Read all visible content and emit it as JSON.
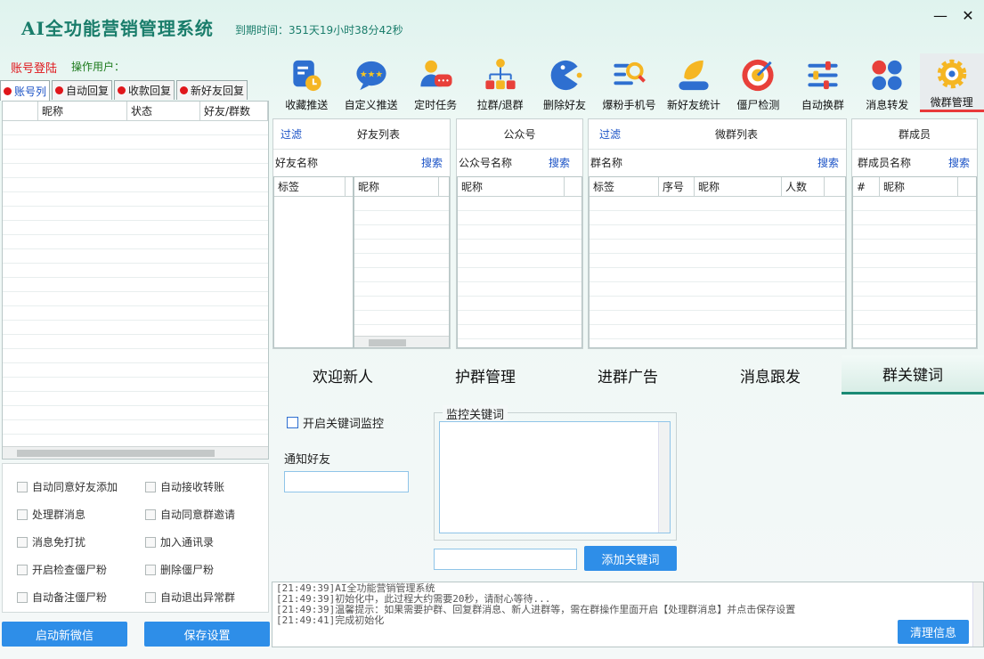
{
  "app": {
    "title": "AI全功能营销管理系统",
    "expire": "到期时间：351天19小时38分42秒"
  },
  "window": {
    "minimize": "—",
    "close": "✕"
  },
  "account": {
    "login": "账号登陆",
    "operator": "操作用户："
  },
  "toolbar": [
    {
      "label": "收藏推送",
      "icon": "bookmark-clock-icon"
    },
    {
      "label": "自定义推送",
      "icon": "chat-stars-icon"
    },
    {
      "label": "定时任务",
      "icon": "person-chat-icon"
    },
    {
      "label": "拉群/退群",
      "icon": "org-chart-icon"
    },
    {
      "label": "删除好友",
      "icon": "pacman-icon"
    },
    {
      "label": "爆粉手机号",
      "icon": "list-search-icon"
    },
    {
      "label": "新好友统计",
      "icon": "leaf-icon"
    },
    {
      "label": "僵尸检测",
      "icon": "target-icon"
    },
    {
      "label": "自动换群",
      "icon": "sliders-icon"
    },
    {
      "label": "消息转发",
      "icon": "four-dots-icon"
    },
    {
      "label": "微群管理",
      "icon": "gear-icon",
      "active": true
    }
  ],
  "left_tabs": [
    "账号列",
    "自动回复",
    "收款回复",
    "新好友回复"
  ],
  "account_table": {
    "columns": [
      "",
      "昵称",
      "状态",
      "好友/群数"
    ]
  },
  "left_options": [
    [
      "自动同意好友添加",
      "自动接收转账"
    ],
    [
      "处理群消息",
      "自动同意群邀请"
    ],
    [
      "消息免打扰",
      "加入通讯录"
    ],
    [
      "开启检查僵尸粉",
      "删除僵尸粉"
    ],
    [
      "自动备注僵尸粉",
      "自动退出异常群"
    ]
  ],
  "left_buttons": {
    "start": "启动新微信",
    "save": "保存设置"
  },
  "friends": {
    "filter": "过滤",
    "title": "好友列表",
    "name_label": "好友名称",
    "search": "搜索",
    "col_tag": "标签",
    "col_nick": "昵称"
  },
  "official": {
    "title": "公众号",
    "name_label": "公众号名称",
    "search": "搜索",
    "col_nick": "昵称"
  },
  "groups": {
    "filter": "过滤",
    "title": "微群列表",
    "name_label": "群名称",
    "search": "搜索",
    "columns": [
      "标签",
      "序号",
      "昵称",
      "人数"
    ]
  },
  "members": {
    "title": "群成员",
    "name_label": "群成员名称",
    "search": "搜索",
    "columns": [
      "#",
      "昵称"
    ]
  },
  "sub_tabs": [
    "欢迎新人",
    "护群管理",
    "进群广告",
    "消息跟发",
    "群关键词"
  ],
  "keyword": {
    "enable": "开启关键词监控",
    "notify": "通知好友",
    "monitor_group": "监控关键词",
    "add_button": "添加关键词"
  },
  "log": {
    "lines": [
      "[21:49:39]AI全功能营销管理系统",
      "[21:49:39]初始化中，此过程大约需要20秒，请耐心等待...",
      "[21:49:39]温馨提示：如果需要护群、回复群消息、新人进群等，需在群操作里面开启【处理群消息】并点击保存设置",
      "[21:49:41]完成初始化"
    ],
    "clear": "清理信息"
  }
}
